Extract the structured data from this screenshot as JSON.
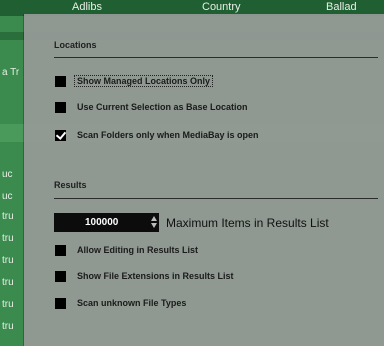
{
  "background": {
    "header": [
      "Adlibs",
      "Country",
      "Ballad"
    ],
    "rows": [
      "a Tr",
      "uc",
      "uc",
      "tru",
      "tru",
      "tru",
      "tru",
      "tru",
      "tru"
    ]
  },
  "locations": {
    "title": "Locations",
    "options": [
      {
        "label": "Show Managed Locations Only",
        "checked": false
      },
      {
        "label": "Use Current Selection as Base Location",
        "checked": false
      },
      {
        "label": "Scan Folders only when MediaBay is open",
        "checked": true
      }
    ]
  },
  "results": {
    "title": "Results",
    "max_items_value": "100000",
    "max_items_label": "Maximum Items in Results List",
    "options": [
      {
        "label": "Allow Editing in Results List",
        "checked": false
      },
      {
        "label": "Show File Extensions in Results List",
        "checked": false
      },
      {
        "label": "Scan unknown File Types",
        "checked": false
      }
    ]
  },
  "colors": {
    "overlay": "#969a98",
    "background_green": "#3b8a4e",
    "checkbox": "#000000"
  }
}
